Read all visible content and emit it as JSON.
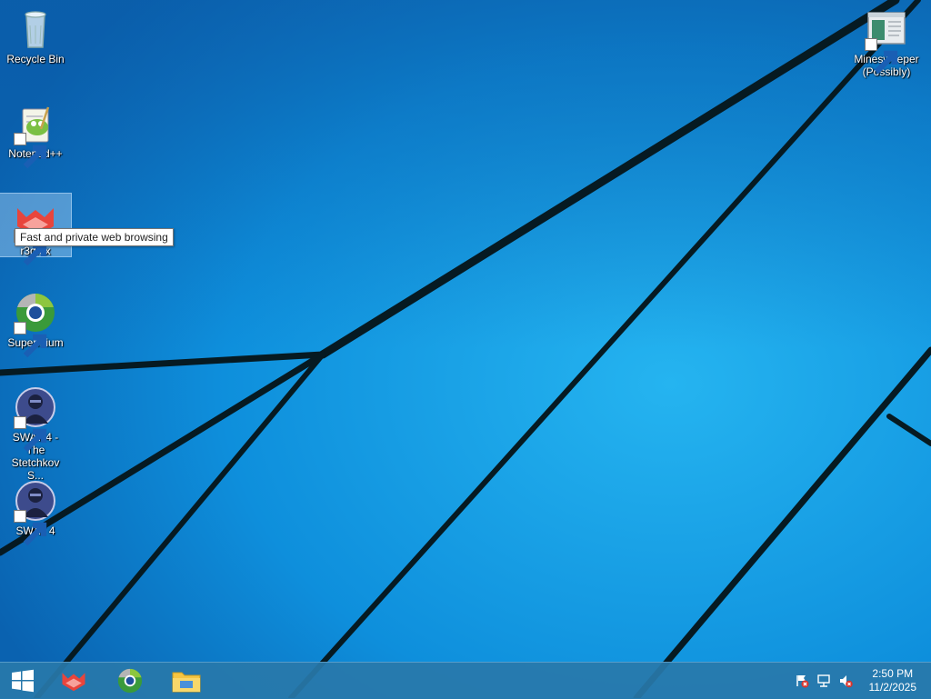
{
  "desktop": {
    "icons": [
      {
        "id": "recycle-bin",
        "label": "Recycle Bin"
      },
      {
        "id": "notepadpp",
        "label": "Notepad++"
      },
      {
        "id": "r3dfox",
        "label": "r3dfox"
      },
      {
        "id": "supermium",
        "label": "Supermium"
      },
      {
        "id": "swat4-stetchkov",
        "label": "SWAT 4 - The Stetchkov S..."
      },
      {
        "id": "swat4",
        "label": "SWAT 4"
      },
      {
        "id": "minesweeper",
        "label": "Minesweeper (Possibly)"
      }
    ],
    "tooltip": "Fast and private web browsing"
  },
  "taskbar": {
    "start_icon": "windows-logo-icon",
    "pinned": [
      {
        "name": "r3dfox",
        "icon": "r3dfox-icon"
      },
      {
        "name": "Supermium",
        "icon": "supermium-icon"
      },
      {
        "name": "File Explorer",
        "icon": "folder-icon"
      }
    ],
    "tray": [
      "action-center-flag-icon",
      "network-icon",
      "volume-muted-icon"
    ],
    "clock": {
      "time": "2:50 PM",
      "date": "11/2/2025"
    }
  },
  "colors": {
    "wallpaper": "#0a7fd2",
    "taskbar": "#2878aa",
    "accent": "#e8453c"
  }
}
